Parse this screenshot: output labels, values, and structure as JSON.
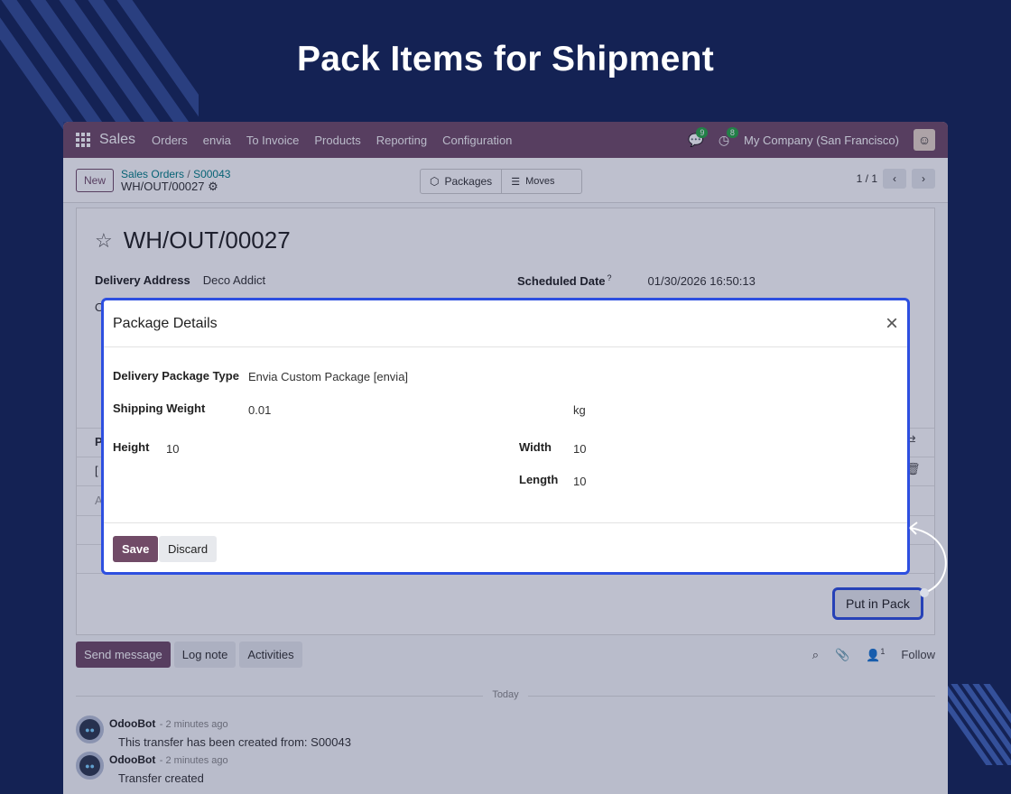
{
  "headline": "Pack Items for Shipment",
  "navbar": {
    "app_name": "Sales",
    "items": [
      "Orders",
      "envia",
      "To Invoice",
      "Products",
      "Reporting",
      "Configuration"
    ],
    "messages_count": "9",
    "activities_count": "8",
    "company": "My Company (San Francisco)"
  },
  "control": {
    "new_label": "New",
    "breadcrumb_parent": "Sales Orders",
    "breadcrumb_order": "S00043",
    "breadcrumb_current": "WH/OUT/00027",
    "packages_label": "Packages",
    "moves_label": "Moves",
    "pager": "1 / 1"
  },
  "record": {
    "title": "WH/OUT/00027",
    "delivery_address_label": "Delivery Address",
    "delivery_address_value": "Deco Addict",
    "scheduled_date_label": "Scheduled Date",
    "scheduled_date_help": "?",
    "scheduled_date_value": "01/30/2026 16:50:13",
    "frag_o": "O",
    "frag_p": "P",
    "frag_bracket": "[",
    "frag_a": "A",
    "put_in_pack_label": "Put in Pack"
  },
  "modal": {
    "title": "Package Details",
    "package_type_label": "Delivery Package Type",
    "package_type_value": "Envia Custom Package [envia]",
    "weight_label": "Shipping Weight",
    "weight_value": "0.01",
    "weight_unit": "kg",
    "height_label": "Height",
    "height_value": "10",
    "width_label": "Width",
    "width_value": "10",
    "length_label": "Length",
    "length_value": "10",
    "save_label": "Save",
    "discard_label": "Discard"
  },
  "chatter": {
    "send_message": "Send message",
    "log_note": "Log note",
    "activities": "Activities",
    "followers_count": "1",
    "follow": "Follow",
    "today": "Today",
    "messages": [
      {
        "author": "OdooBot",
        "time": "- 2 minutes ago",
        "text": "This transfer has been created from: S00043"
      },
      {
        "author": "OdooBot",
        "time": "- 2 minutes ago",
        "text": "Transfer created"
      }
    ]
  },
  "colors": {
    "background": "#142254",
    "navbar": "#714b67",
    "highlight": "#2d4fe0"
  }
}
